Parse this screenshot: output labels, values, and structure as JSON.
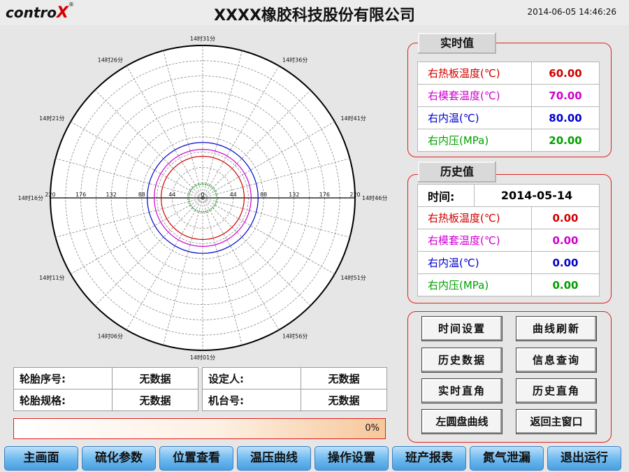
{
  "header": {
    "logo_text": "contro",
    "logo_x": "X",
    "logo_mark": "®",
    "company": "XXXX橡胶科技股份有限公司",
    "datetime": "2014-06-05 14:46:26"
  },
  "polar_chart": {
    "time_labels": [
      "14时31分",
      "14时36分",
      "14时41分",
      "14时46分",
      "14时51分",
      "14时56分",
      "14时01分",
      "14时06分",
      "14时11分",
      "14时16分",
      "14时21分",
      "14时26分"
    ],
    "radial_ticks_left": [
      "220",
      "176",
      "132",
      "88",
      "44",
      "0"
    ],
    "radial_ticks_right": [
      "0",
      "44",
      "88",
      "132",
      "176",
      "220"
    ],
    "colors": {
      "hot_plate": "#d00000",
      "mold_sleeve": "#d000d0",
      "inner_temp": "#0000cc",
      "inner_press": "#00a000"
    }
  },
  "realtime": {
    "title": "实时值",
    "rows": [
      {
        "label": "右热板温度(℃)",
        "value": "60.00",
        "color": "#d00000"
      },
      {
        "label": "右模套温度(℃)",
        "value": "70.00",
        "color": "#d000d0"
      },
      {
        "label": "右内温(℃)",
        "value": "80.00",
        "color": "#0000cc"
      },
      {
        "label": "右内压(MPa)",
        "value": "20.00",
        "color": "#00a000"
      }
    ]
  },
  "history": {
    "title": "历史值",
    "time_label": "时间:",
    "time_value": "2014-05-14",
    "rows": [
      {
        "label": "右热板温度(℃)",
        "value": "0.00",
        "color": "#d00000"
      },
      {
        "label": "右模套温度(℃)",
        "value": "0.00",
        "color": "#d000d0"
      },
      {
        "label": "右内温(℃)",
        "value": "0.00",
        "color": "#0000cc"
      },
      {
        "label": "右内压(MPa)",
        "value": "0.00",
        "color": "#00a000"
      }
    ]
  },
  "buttons": {
    "time_set": "时间设置",
    "curve_refresh": "曲线刷新",
    "history_data": "历史数据",
    "info_query": "信息查询",
    "realtime_rect": "实时直角",
    "history_rect": "历史直角",
    "left_disc": "左圆盘曲线",
    "back_main": "返回主窗口"
  },
  "info": {
    "tire_seq_label": "轮胎序号:",
    "tire_seq_value": "无数据",
    "setter_label": "设定人:",
    "setter_value": "无数据",
    "tire_spec_label": "轮胎规格:",
    "tire_spec_value": "无数据",
    "machine_label": "机台号:",
    "machine_value": "无数据"
  },
  "progress": {
    "value": 0,
    "text": "0%"
  },
  "nav": [
    "主画面",
    "硫化参数",
    "位置查看",
    "温压曲线",
    "操作设置",
    "班产报表",
    "氮气泄漏",
    "退出运行"
  ]
}
